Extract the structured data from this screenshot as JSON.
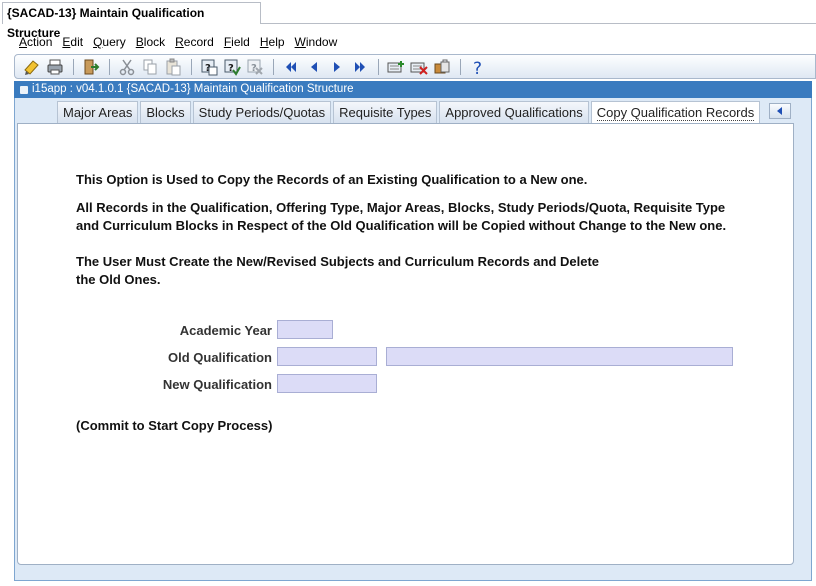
{
  "window": {
    "tab_title": "{SACAD-13} Maintain Qualification Structure"
  },
  "menu": [
    {
      "label": "Action",
      "u": "A",
      "rest": "ction"
    },
    {
      "label": "Edit",
      "u": "E",
      "rest": "dit"
    },
    {
      "label": "Query",
      "u": "Q",
      "rest": "uery"
    },
    {
      "label": "Block",
      "u": "B",
      "rest": "lock"
    },
    {
      "label": "Record",
      "u": "R",
      "rest": "ecord"
    },
    {
      "label": "Field",
      "u": "F",
      "rest": "ield"
    },
    {
      "label": "Help",
      "u": "H",
      "rest": "elp"
    },
    {
      "label": "Window",
      "u": "W",
      "rest": "indow"
    }
  ],
  "toolbar_icons": [
    "save-icon",
    "print-icon",
    "exit-icon",
    "cut-icon",
    "copy-icon",
    "paste-icon",
    "enter-query-icon",
    "execute-query-icon",
    "cancel-query-icon",
    "first-record-icon",
    "previous-record-icon",
    "next-record-icon",
    "last-record-icon",
    "insert-record-icon",
    "delete-record-icon",
    "lock-record-icon",
    "help-icon"
  ],
  "form": {
    "title": "i15app : v04.1.0.1  {SACAD-13} Maintain Qualification Structure"
  },
  "tabs": [
    {
      "label": "Major Areas",
      "active": false
    },
    {
      "label": "Blocks",
      "active": false
    },
    {
      "label": "Study Periods/Quotas",
      "active": false
    },
    {
      "label": "Requisite Types",
      "active": false
    },
    {
      "label": "Approved Qualifications",
      "active": false
    },
    {
      "label": "Copy Qualification Records",
      "active": true
    }
  ],
  "content": {
    "line1": "This Option is Used to Copy the Records of an Existing Qualification to a New one.",
    "line2": "All Records in the Qualification, Offering Type, Major Areas, Blocks, Study Periods/Quota, Requisite Type",
    "line3": "and Curriculum Blocks in Respect of the Old Qualification will be Copied without Change to the New one.",
    "line4": "The User Must Create the New/Revised Subjects and Curriculum Records and Delete",
    "line5": "the Old Ones.",
    "commit_note": "(Commit to Start Copy Process)"
  },
  "fields": {
    "academic_year": {
      "label": "Academic Year",
      "value": ""
    },
    "old_qualification": {
      "label": "Old Qualification",
      "value": "",
      "description": ""
    },
    "new_qualification": {
      "label": "New Qualification",
      "value": ""
    }
  },
  "colors": {
    "form_title_bar": "#3a7bbf",
    "field_background": "#dcdcf7",
    "frame_background": "#dde9f6"
  }
}
